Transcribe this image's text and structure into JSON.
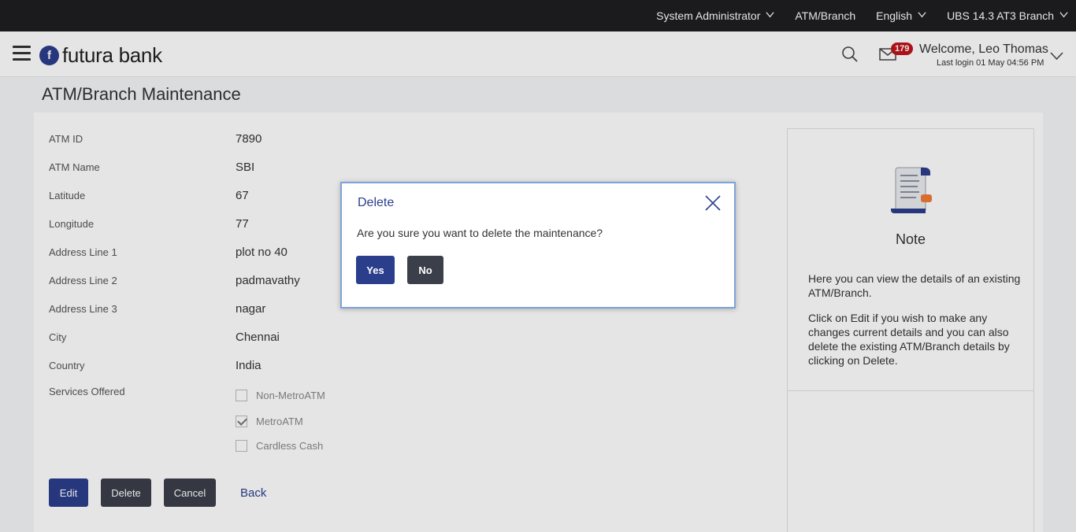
{
  "topbar": {
    "role": "System Administrator",
    "entity": "ATM/Branch",
    "language": "English",
    "branch": "UBS 14.3 AT3 Branch"
  },
  "header": {
    "logo_text": "futura bank",
    "logo_mark": "f",
    "mail_count": "179",
    "welcome": "Welcome, Leo Thomas",
    "last_login": "Last login 01 May 04:56 PM"
  },
  "page": {
    "title": "ATM/Branch Maintenance",
    "fields": [
      {
        "label": "ATM ID",
        "value": "7890"
      },
      {
        "label": "ATM Name",
        "value": "SBI"
      },
      {
        "label": "Latitude",
        "value": "67"
      },
      {
        "label": "Longitude",
        "value": "77"
      },
      {
        "label": "Address Line 1",
        "value": "plot no 40"
      },
      {
        "label": "Address Line 2",
        "value": "padmavathy"
      },
      {
        "label": "Address Line 3",
        "value": "nagar"
      },
      {
        "label": "City",
        "value": "Chennai"
      },
      {
        "label": "Country",
        "value": "India"
      }
    ],
    "services_label": "Services Offered",
    "services": [
      {
        "label": "Non-MetroATM",
        "checked": false
      },
      {
        "label": "MetroATM",
        "checked": true
      },
      {
        "label": "Cardless Cash",
        "checked": false
      }
    ],
    "buttons": {
      "edit": "Edit",
      "delete": "Delete",
      "cancel": "Cancel",
      "back": "Back"
    }
  },
  "note": {
    "title": "Note",
    "p1": "Here you can view the details of an existing ATM/Branch.",
    "p2": "Click on Edit if you wish to make any changes current details and you can also delete the existing ATM/Branch details by clicking on Delete."
  },
  "modal": {
    "title": "Delete",
    "message": "Are you sure you want to delete the maintenance?",
    "yes": "Yes",
    "no": "No"
  },
  "colors": {
    "primary": "#2b3e8c",
    "dark_button": "#3b3f4a",
    "topbar": "#1f1f21",
    "badge": "#c0131b"
  }
}
